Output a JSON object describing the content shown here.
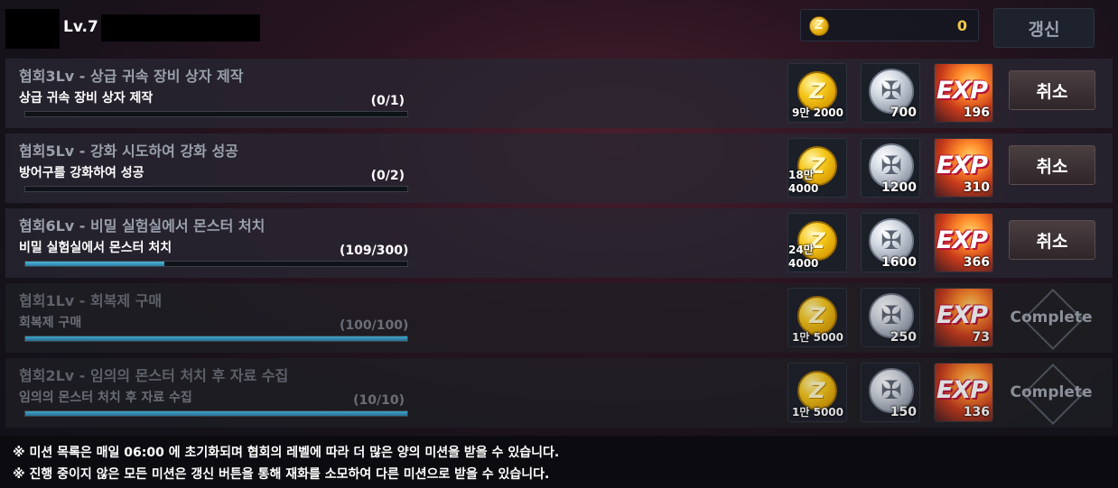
{
  "header": {
    "level": "Lv.7",
    "currency_amount": "0",
    "refresh_label": "갱신"
  },
  "missions": [
    {
      "title": "협회3Lv - 상급 귀속 장비 상자 제작",
      "desc": "상급 귀속 장비 상자 제작",
      "progress": "(0/1)",
      "progress_fraction": 0.0,
      "gold": "9만 2000",
      "silver": "700",
      "exp": "196",
      "action": "취소",
      "completed": false
    },
    {
      "title": "협회5Lv - 강화 시도하여 강화 성공",
      "desc": "방어구를 강화하여 성공",
      "progress": "(0/2)",
      "progress_fraction": 0.0,
      "gold": "18만 4000",
      "silver": "1200",
      "exp": "310",
      "action": "취소",
      "completed": false
    },
    {
      "title": "협회6Lv - 비밀 실험실에서 몬스터 처치",
      "desc": "비밀 실험실에서 몬스터 처치",
      "progress": "(109/300)",
      "progress_fraction": 0.363,
      "gold": "24만 4000",
      "silver": "1600",
      "exp": "366",
      "action": "취소",
      "completed": false
    },
    {
      "title": "협회1Lv - 회복제 구매",
      "desc": "회복제 구매",
      "progress": "(100/100)",
      "progress_fraction": 1.0,
      "gold": "1만 5000",
      "silver": "250",
      "exp": "73",
      "action": "Complete",
      "completed": true
    },
    {
      "title": "협회2Lv - 임의의 몬스터 처치 후 자료 수집",
      "desc": "임의의 몬스터 처치 후 자료 수집",
      "progress": "(10/10)",
      "progress_fraction": 1.0,
      "gold": "1만 5000",
      "silver": "150",
      "exp": "136",
      "action": "Complete",
      "completed": true
    }
  ],
  "icons": {
    "gold": "gold-coin-icon",
    "silver": "silver-medal-icon",
    "exp": "exp-icon"
  },
  "exp_label": "EXP",
  "footer": {
    "note1": "※ 미션 목록은 매일 06:00 에 초기화되며 협회의 레벨에 따라 더 많은 양의 미션을 받을 수 있습니다.",
    "note2": "※ 진행 중이지 않은 모든 미션은 갱신 버튼을 통해 재화를 소모하여 다른 미션으로 받을 수 있습니다."
  }
}
